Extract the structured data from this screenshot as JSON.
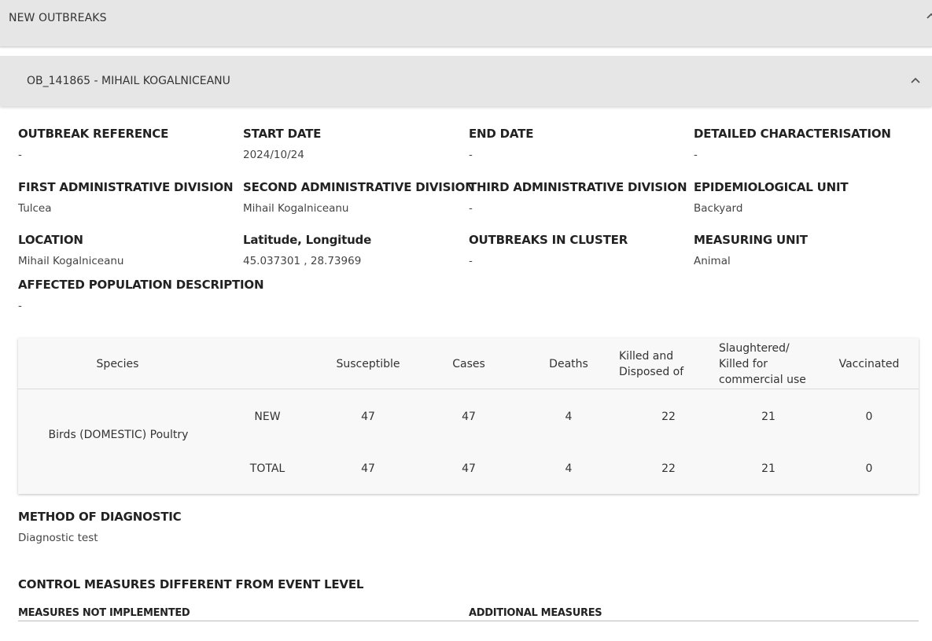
{
  "top_panel": {
    "title": "NEW OUTBREAKS"
  },
  "outbreak_panel": {
    "title": "OB_141865 - MIHAIL KOGALNICEANU"
  },
  "fields": {
    "outbreak_reference": {
      "label": "OUTBREAK REFERENCE",
      "value": "-"
    },
    "start_date": {
      "label": "START DATE",
      "value": "2024/10/24"
    },
    "end_date": {
      "label": "END DATE",
      "value": "-"
    },
    "detailed_characterisation": {
      "label": "DETAILED CHARACTERISATION",
      "value": "-"
    },
    "first_admin": {
      "label": "FIRST ADMINISTRATIVE DIVISION",
      "value": "Tulcea"
    },
    "second_admin": {
      "label": "SECOND ADMINISTRATIVE DIVISION",
      "value": "Mihail Kogalniceanu"
    },
    "third_admin": {
      "label": "THIRD ADMINISTRATIVE DIVISION",
      "value": "-"
    },
    "epi_unit": {
      "label": "EPIDEMIOLOGICAL UNIT",
      "value": "Backyard"
    },
    "location": {
      "label": "LOCATION",
      "value": "Mihail Kogalniceanu"
    },
    "lat_long": {
      "label": "Latitude, Longitude",
      "value": "45.037301 , 28.73969"
    },
    "outbreaks_in_cluster": {
      "label": "OUTBREAKS IN CLUSTER",
      "value": "-"
    },
    "measuring_unit": {
      "label": "MEASURING UNIT",
      "value": "Animal"
    },
    "affected_population": {
      "label": "AFFECTED POPULATION DESCRIPTION",
      "value": "-"
    }
  },
  "table": {
    "headers": {
      "species": "Species",
      "susceptible": "Susceptible",
      "cases": "Cases",
      "deaths": "Deaths",
      "killed": "Killed and Disposed of",
      "slaughtered": "Slaughtered/ Killed for commercial use",
      "vaccinated": "Vaccinated"
    },
    "species_name": "Birds (DOMESTIC) Poultry",
    "rows": [
      {
        "type": "NEW",
        "susceptible": "47",
        "cases": "47",
        "deaths": "4",
        "killed": "22",
        "slaughtered": "21",
        "vaccinated": "0"
      },
      {
        "type": "TOTAL",
        "susceptible": "47",
        "cases": "47",
        "deaths": "4",
        "killed": "22",
        "slaughtered": "21",
        "vaccinated": "0"
      }
    ]
  },
  "diagnostic": {
    "label": "METHOD OF DIAGNOSTIC",
    "value": "Diagnostic test"
  },
  "control_measures": {
    "title": "CONTROL MEASURES DIFFERENT FROM EVENT LEVEL",
    "not_implemented": "MEASURES NOT IMPLEMENTED",
    "additional": "ADDITIONAL MEASURES"
  },
  "icons": {
    "collapse": "chevron-up-icon"
  }
}
